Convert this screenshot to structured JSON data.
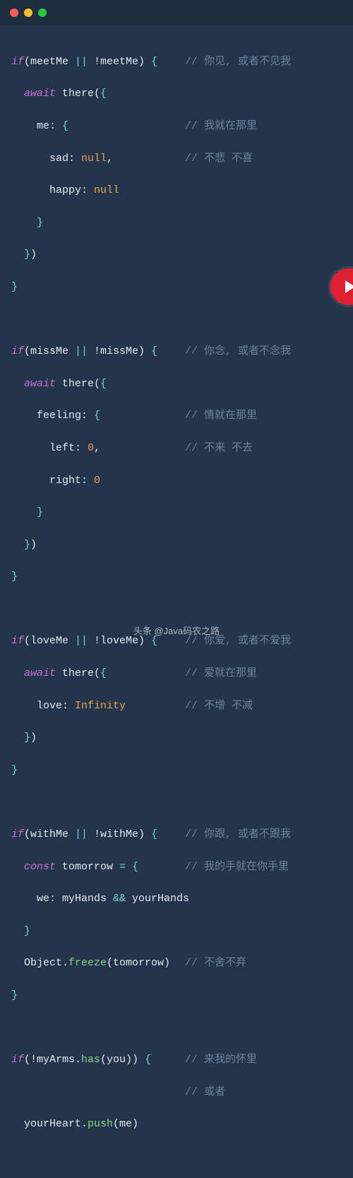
{
  "window": {
    "dots": [
      "close",
      "minimize",
      "zoom"
    ]
  },
  "code": {
    "l01a": "if",
    "l01b": "(meetMe ",
    "l01c": "||",
    "l01d": " !meetMe) ",
    "l01e": "{",
    "c01": "// 你见, 或者不见我",
    "l02a": "  ",
    "l02b": "await",
    "l02c": " there(",
    "l02d": "{",
    "l03a": "    me: ",
    "l03b": "{",
    "c03": "// 我就在那里",
    "l04a": "      sad: ",
    "l04b": "null",
    "l04c": ",",
    "c04": "// 不悲 不喜",
    "l05a": "      happy: ",
    "l05b": "null",
    "l06a": "    ",
    "l06b": "}",
    "l07a": "  ",
    "l07b": "}",
    "l07c": ")",
    "l08a": "}",
    "l10a": "if",
    "l10b": "(missMe ",
    "l10c": "||",
    "l10d": " !missMe) ",
    "l10e": "{",
    "c10": "// 你念, 或者不念我",
    "l11a": "  ",
    "l11b": "await",
    "l11c": " there(",
    "l11d": "{",
    "l12a": "    feeling: ",
    "l12b": "{",
    "c12": "// 情就在那里",
    "l13a": "      left: ",
    "l13b": "0",
    "l13c": ",",
    "c13": "// 不来 不去",
    "l14a": "      right: ",
    "l14b": "0",
    "l15a": "    ",
    "l15b": "}",
    "l16a": "  ",
    "l16b": "}",
    "l16c": ")",
    "l17a": "}",
    "l19a": "if",
    "l19b": "(loveMe ",
    "l19c": "||",
    "l19d": " !loveMe) ",
    "l19e": "{",
    "c19": "// 你爱, 或者不爱我",
    "l20a": "  ",
    "l20b": "await",
    "l20c": " there(",
    "l20d": "{",
    "c20": "// 爱就在那里",
    "l21a": "    love: ",
    "l21b": "Infinity",
    "c21": "// 不增 不减",
    "l22a": "  ",
    "l22b": "}",
    "l22c": ")",
    "l23a": "}",
    "l25a": "if",
    "l25b": "(withMe ",
    "l25c": "||",
    "l25d": " !withMe) ",
    "l25e": "{",
    "c25": "// 你跟, 或者不跟我",
    "l26a": "  ",
    "l26b": "const",
    "l26c": " tomorrow ",
    "l26d": "=",
    "l26e": " ",
    "l26f": "{",
    "c26": "// 我的手就在你手里",
    "l27a": "    we: myHands ",
    "l27b": "&&",
    "l27c": " yourHands",
    "l28a": "  ",
    "l28b": "}",
    "l29a": "  Object.",
    "l29b": "freeze",
    "l29c": "(tomorrow) ",
    "c29": "// 不舍不弃",
    "l30a": "}",
    "l32a": "if",
    "l32b": "(!myArms.",
    "l32c": "has",
    "l32d": "(you)) ",
    "l32e": "{",
    "c32": "// 来我的怀里",
    "c33": "// 或者",
    "l34a": "  yourHeart.",
    "l34b": "push",
    "l34c": "(me)"
  },
  "footer": {
    "text": "头条 @Java码农之路"
  }
}
